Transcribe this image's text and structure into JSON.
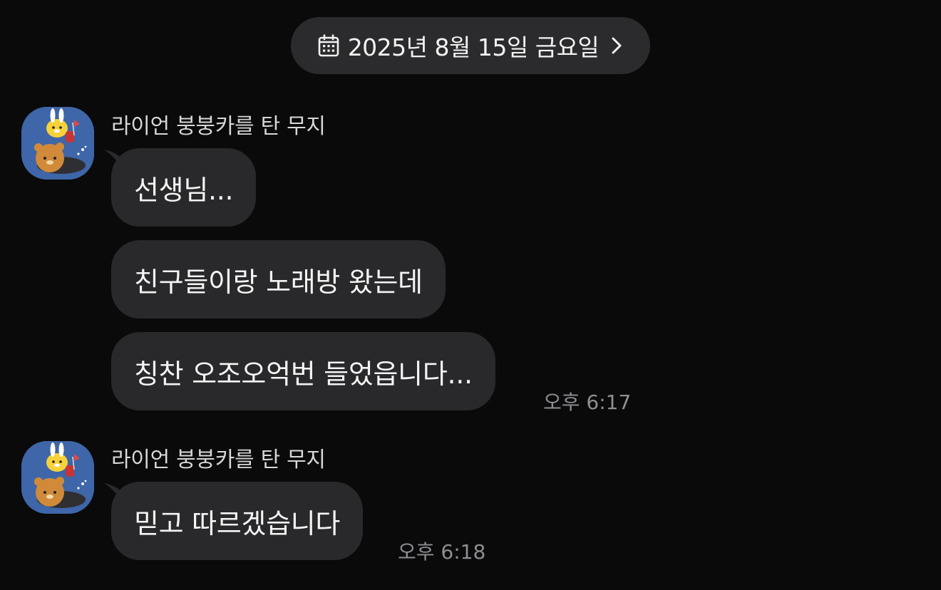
{
  "date_divider": {
    "label": "2025년 8월 15일 금요일",
    "icon": "calendar-icon",
    "trailing_icon": "chevron-right-icon"
  },
  "message_groups": [
    {
      "sender": "라이언 붕붕카를 탄 무지",
      "avatar_icon": "muzi-riding-ryan-avatar",
      "messages": [
        "선생님...",
        "친구들이랑 노래방 왔는데",
        "칭찬 오조오억번 들었읍니다..."
      ],
      "time": "오후 6:17"
    },
    {
      "sender": "라이언 붕붕카를 탄 무지",
      "avatar_icon": "muzi-riding-ryan-avatar",
      "messages": [
        "믿고 따르겠습니다"
      ],
      "time": "오후 6:18"
    }
  ],
  "colors": {
    "background": "#0a0a0b",
    "bubble": "#29292b",
    "date_pill": "#2b2b2d",
    "avatar_bg": "#3e66a8",
    "timestamp": "#8f8f93"
  }
}
